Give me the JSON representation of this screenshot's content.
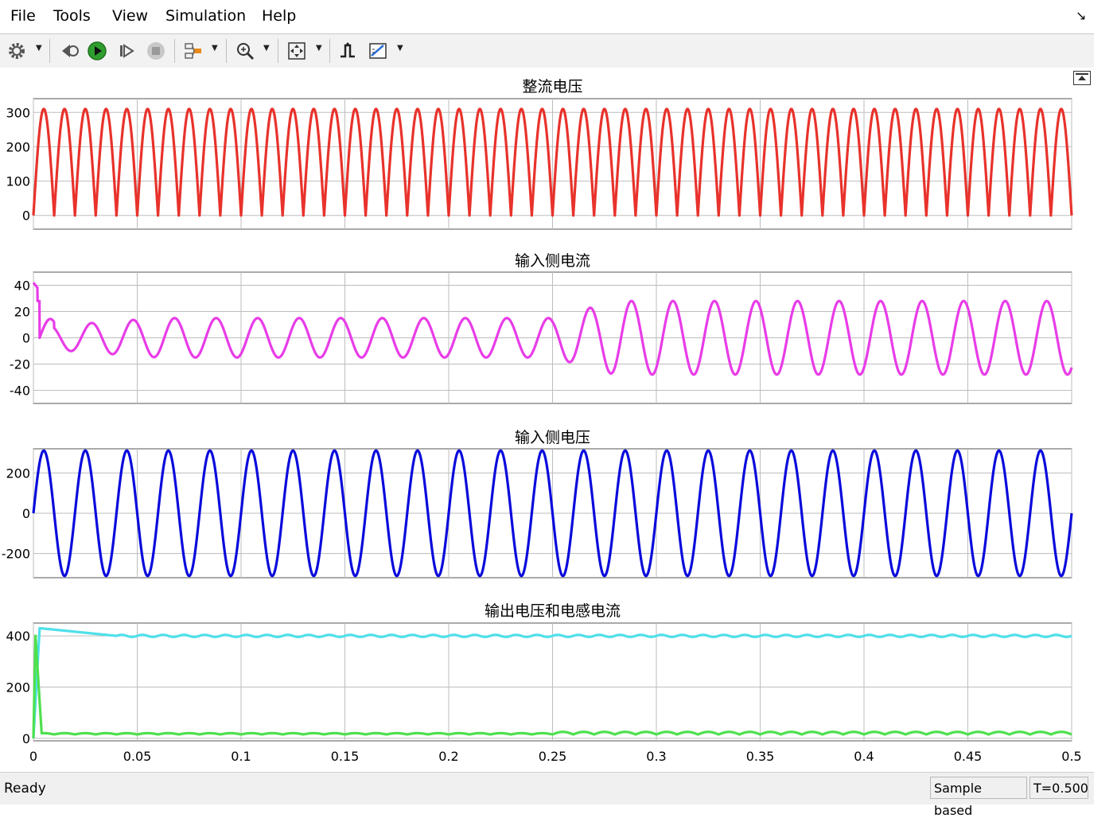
{
  "menu": [
    "File",
    "Tools",
    "View",
    "Simulation",
    "Help"
  ],
  "toolbar": {
    "icons": [
      "gear-icon",
      "step-back-icon",
      "run-icon",
      "step-forward-icon",
      "stop-icon",
      "signal-select-icon",
      "zoom-icon",
      "fit-to-view-icon",
      "triggers-icon",
      "measurements-icon"
    ]
  },
  "colors": {
    "rectified_voltage": "#e8322b",
    "input_current": "#e83ce8",
    "input_voltage": "#0a0adc",
    "output_voltage": "#4fe0ea",
    "inductor_current": "#4ee04e",
    "grid": "#bdbdbd"
  },
  "status": {
    "left": "Ready",
    "mode": "Sample based",
    "time": "T=0.500"
  },
  "chart_data": [
    {
      "type": "line",
      "title": "整流电压",
      "xlim": [
        0,
        0.5
      ],
      "ylim": [
        -40,
        340
      ],
      "yticks": [
        0,
        100,
        200,
        300
      ],
      "grid": true,
      "series": [
        {
          "waveform": "full-wave rectified sine",
          "peak": 310,
          "min": 0,
          "frequency_hz": 100,
          "color": "#e8322b"
        }
      ]
    },
    {
      "type": "line",
      "title": "输入侧电流",
      "xlim": [
        0,
        0.5
      ],
      "ylim": [
        -50,
        50
      ],
      "yticks": [
        -40,
        -20,
        0,
        20,
        40
      ],
      "grid": true,
      "series": [
        {
          "waveform": "sine",
          "frequency_hz": 50,
          "initial_spike": 42,
          "amplitude_0_to_0_25": 15,
          "amplitude_0_25_to_0_5": 27,
          "color": "#e83ce8"
        }
      ]
    },
    {
      "type": "line",
      "title": "输入侧电压",
      "xlim": [
        0,
        0.5
      ],
      "ylim": [
        -320,
        320
      ],
      "yticks": [
        -200,
        0,
        200
      ],
      "grid": true,
      "series": [
        {
          "waveform": "sine",
          "amplitude": 311,
          "frequency_hz": 50,
          "color": "#0a0adc"
        }
      ]
    },
    {
      "type": "line",
      "title": "输出电压和电感电流",
      "xlim": [
        0,
        0.5
      ],
      "ylim": [
        -10,
        450
      ],
      "yticks": [
        0,
        200,
        400
      ],
      "xticks": [
        "0",
        "0.05",
        "0.1",
        "0.15",
        "0.2",
        "0.25",
        "0.3",
        "0.35",
        "0.4",
        "0.45",
        "0.5"
      ],
      "grid": true,
      "series": [
        {
          "waveform": "dc with ripple",
          "steady_value": 400,
          "overshoot": 430,
          "color": "#4fe0ea"
        },
        {
          "waveform": "startup spike then ripple",
          "peak": 400,
          "steady_value": 15,
          "ripple": 10,
          "color": "#4ee04e"
        }
      ]
    }
  ]
}
